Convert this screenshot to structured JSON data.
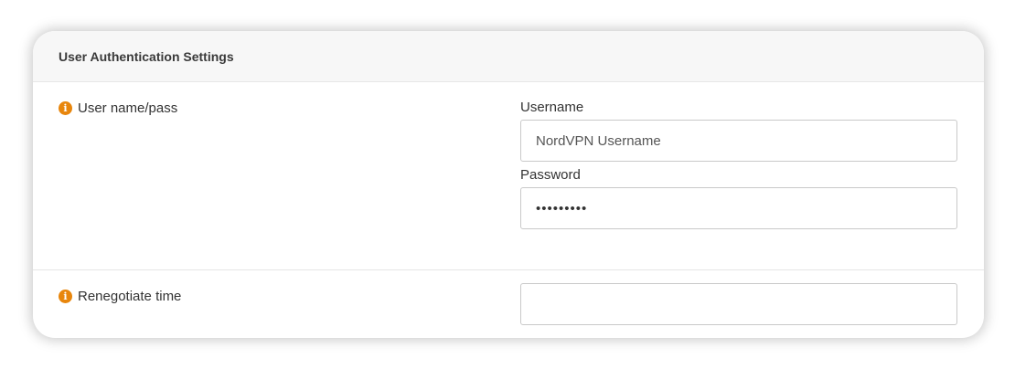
{
  "panel": {
    "title": "User Authentication Settings"
  },
  "auth_row": {
    "label": "User name/pass",
    "icon": "info-icon",
    "username": {
      "label": "Username",
      "placeholder": "NordVPN Username",
      "value": ""
    },
    "password": {
      "label": "Password",
      "value": "•••••••••"
    }
  },
  "renegotiate_row": {
    "label": "Renegotiate time",
    "icon": "info-icon",
    "value": ""
  },
  "colors": {
    "info_icon": "#e8860c",
    "header_bg": "#f7f7f7",
    "input_border": "#c9c9c9"
  }
}
